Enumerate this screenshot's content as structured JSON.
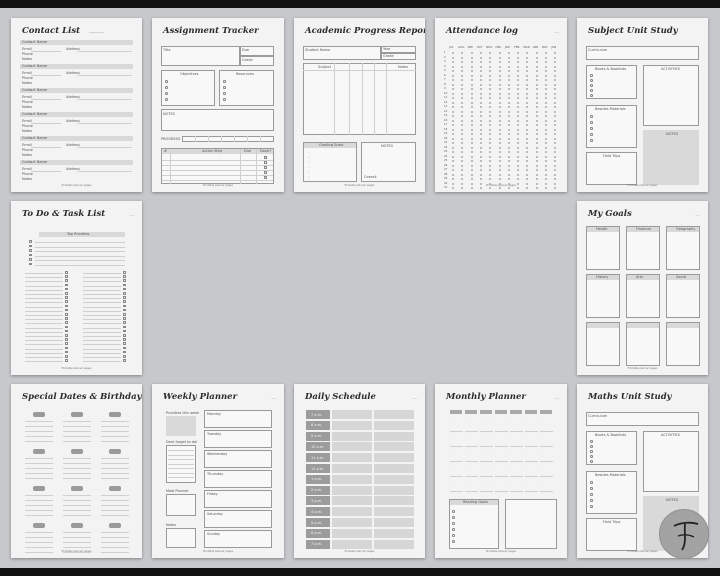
{
  "pages": {
    "contact_list": {
      "title": "Contact List",
      "field_name": "Contact Name",
      "field_email": "Email",
      "field_phone": "Phone",
      "field_notes": "Notes",
      "field_address": "Address"
    },
    "assignment_tracker": {
      "title": "Assignment Tracker",
      "title_label": "Title",
      "due_label": "Due",
      "grade_label": "Grade",
      "objectives_label": "Objectives",
      "resources_label": "Resources",
      "notes_label": "NOTES",
      "progress_label": "PROGRESS",
      "col_number": "#",
      "col_action": "Action Step",
      "col_due": "Due",
      "col_done": "Done?"
    },
    "academic_progress": {
      "title": "Academic Progress Report",
      "student_label": "Student Name",
      "year_label": "Year",
      "grade_label": "Grade",
      "subject_label": "Subject",
      "notes_label": "Notes",
      "grading_label": "Grading Scale",
      "notes2_label": "NOTES",
      "overall_label": "Overall"
    },
    "attendance_log": {
      "title": "Attendance log",
      "months": [
        "JUL",
        "AUG",
        "SEP",
        "OCT",
        "NOV",
        "DEC",
        "JAN",
        "FEB",
        "MAR",
        "APR",
        "MAY",
        "JUN"
      ]
    },
    "subject_unit": {
      "title": "Subject Unit Study",
      "curriculum_label": "Curriculum",
      "books_label": "Books & Booklists",
      "activities_label": "ACTIVITIES",
      "resources_label": "Besides Materials",
      "notes_label": "NOTES",
      "field_trips_label": "Field Trips"
    },
    "todo": {
      "title": "To Do & Task List",
      "top_priorities_label": "Top Priorities"
    },
    "my_goals": {
      "title": "My Goals",
      "cells": [
        "Health",
        "Finances",
        "Geography",
        "History",
        "Arts",
        "Social",
        "",
        "",
        ""
      ]
    },
    "special_dates": {
      "title": "Special Dates & Birthdays"
    },
    "weekly_planner": {
      "title": "Weekly Planner",
      "priorities_label": "Priorities this week",
      "dont_forget_label": "Dont forget to do!",
      "meal_planner_label": "Meal Planner",
      "notes_label": "Notes",
      "days": [
        "Monday",
        "Tuesday",
        "Wednesday",
        "Thursday",
        "Friday",
        "Saturday",
        "Sunday"
      ]
    },
    "daily_schedule": {
      "title": "Daily Schedule",
      "times": [
        "7 a.m.",
        "8 a.m.",
        "9 a.m.",
        "10 a.m.",
        "11 a.m.",
        "12 p.m.",
        "1 p.m.",
        "2 p.m.",
        "3 p.m.",
        "4 p.m.",
        "5 p.m.",
        "6 p.m.",
        "7 p.m."
      ]
    },
    "monthly_planner": {
      "title": "Monthly Planner",
      "reading_label": "Reading Goals"
    },
    "maths_unit": {
      "title": "Maths Unit Study",
      "curriculum_label": "Curriculum",
      "books_label": "Books & Booklists",
      "activities_label": "ACTIVITIES",
      "resources_label": "Besides Materials",
      "notes_label": "NOTES",
      "field_trips_label": "Field Trips"
    }
  },
  "footer_text": "Printable planner pages",
  "logo": {
    "letter": "F"
  },
  "colors": {
    "background": "#c7c8cc",
    "page": "#f3f3f3",
    "accent_gray": "#cfcfcf"
  }
}
